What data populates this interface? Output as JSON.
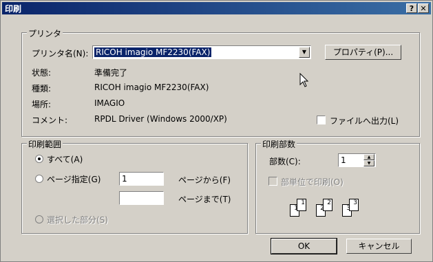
{
  "window": {
    "title": "印刷",
    "help_button": "?",
    "close_button": "✕"
  },
  "printer_group": {
    "legend": "プリンタ",
    "name_label": "プリンタ名(N):",
    "name_value": "RICOH imagio MF2230(FAX)",
    "properties_button": "プロパティ(P)...",
    "status_label": "状態:",
    "status_value": "準備完了",
    "type_label": "種類:",
    "type_value": "RICOH imagio MF2230(FAX)",
    "location_label": "場所:",
    "location_value": "IMAGIO",
    "comment_label": "コメント:",
    "comment_value": "RPDL Driver (Windows 2000/XP)",
    "print_to_file_label": "ファイルへ出力(L)",
    "print_to_file_checked": false
  },
  "range_group": {
    "legend": "印刷範囲",
    "all_label": "すべて(A)",
    "pages_label": "ページ指定(G)",
    "from_value": "1",
    "from_label": "ページから(F)",
    "to_value": "",
    "to_label": "ページまで(T)",
    "selection_label": "選択した部分(S)",
    "selected_option": "all"
  },
  "copies_group": {
    "legend": "印刷部数",
    "copies_label": "部数(C):",
    "copies_value": "1",
    "collate_label": "部単位で印刷(O)",
    "collate_checked": false,
    "page_icons": [
      "1",
      "1",
      "2",
      "2",
      "3",
      "3"
    ]
  },
  "footer": {
    "ok_button": "OK",
    "cancel_button": "キャンセル"
  },
  "colors": {
    "dialog_bg": "#d4d0c8",
    "title_start": "#0a246a",
    "title_end": "#3a6ea5"
  }
}
